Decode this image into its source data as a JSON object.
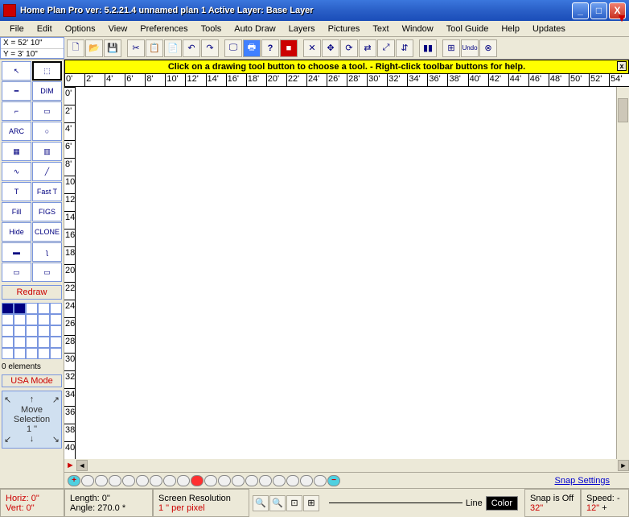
{
  "title": "Home Plan Pro ver: 5.2.21.4    unnamed plan 1        Active Layer: Base Layer",
  "menu": [
    "File",
    "Edit",
    "Options",
    "View",
    "Preferences",
    "Tools",
    "Auto Draw",
    "Layers",
    "Pictures",
    "Text",
    "Window",
    "Tool Guide",
    "Help",
    "Updates"
  ],
  "coords": {
    "x": "X = 52' 10\"",
    "y": "Y = 3' 10\""
  },
  "hint": "Click on a drawing tool button to choose a tool.  -  Right-click toolbar buttons for help.",
  "hruler": [
    "0'",
    "2'",
    "4'",
    "6'",
    "8'",
    "10'",
    "12'",
    "14'",
    "16'",
    "18'",
    "20'",
    "22'",
    "24'",
    "26'",
    "28'",
    "30'",
    "32'",
    "34'",
    "36'",
    "38'",
    "40'",
    "42'",
    "44'",
    "46'",
    "48'",
    "50'",
    "52'",
    "54'"
  ],
  "vruler": [
    "0'",
    "2'",
    "4'",
    "6'",
    "8'",
    "10'",
    "12'",
    "14'",
    "16'",
    "18'",
    "20'",
    "22'",
    "24'",
    "26'",
    "28'",
    "30'",
    "32'",
    "34'",
    "36'",
    "38'",
    "40'"
  ],
  "tools_left": [
    {
      "n": "arrow",
      "l": "↖"
    },
    {
      "n": "select",
      "l": "⬚"
    },
    {
      "n": "wall",
      "l": "━"
    },
    {
      "n": "dim",
      "l": "DIM"
    },
    {
      "n": "door",
      "l": "⌐"
    },
    {
      "n": "rect",
      "l": "▭"
    },
    {
      "n": "arc",
      "l": "ARC"
    },
    {
      "n": "circle",
      "l": "○"
    },
    {
      "n": "stairs",
      "l": "▦"
    },
    {
      "n": "window",
      "l": "▥"
    },
    {
      "n": "curve",
      "l": "∿"
    },
    {
      "n": "line",
      "l": "╱"
    },
    {
      "n": "text",
      "l": "T"
    },
    {
      "n": "fast",
      "l": "Fast T"
    },
    {
      "n": "fill",
      "l": "Fill"
    },
    {
      "n": "figs",
      "l": "FIGS"
    },
    {
      "n": "hide",
      "l": "Hide"
    },
    {
      "n": "clone",
      "l": "CLONE"
    },
    {
      "n": "image",
      "l": "▬"
    },
    {
      "n": "freehand",
      "l": "ʅ"
    },
    {
      "n": "box1",
      "l": "▭"
    },
    {
      "n": "box2",
      "l": "▭"
    }
  ],
  "redraw": "Redraw",
  "elements": "0 elements",
  "usa": "USA Mode",
  "movesel": {
    "l1": "Move",
    "l2": "Selection",
    "l3": "1 \""
  },
  "snap_settings": "Snap Settings",
  "status": {
    "horiz": "Horiz: 0\"",
    "vert": "Vert: 0\"",
    "length": "Length: 0\"",
    "angle": "Angle: 270.0 *",
    "res1": "Screen Resolution",
    "res2": "1 \" per pixel",
    "linetype": "Line",
    "colorbtn": "Color",
    "snap1": "Snap is Off",
    "snap2": "32\"",
    "speed1": "Speed:",
    "speed2": "12\"",
    "speedx": "-",
    "speedp": "+"
  }
}
